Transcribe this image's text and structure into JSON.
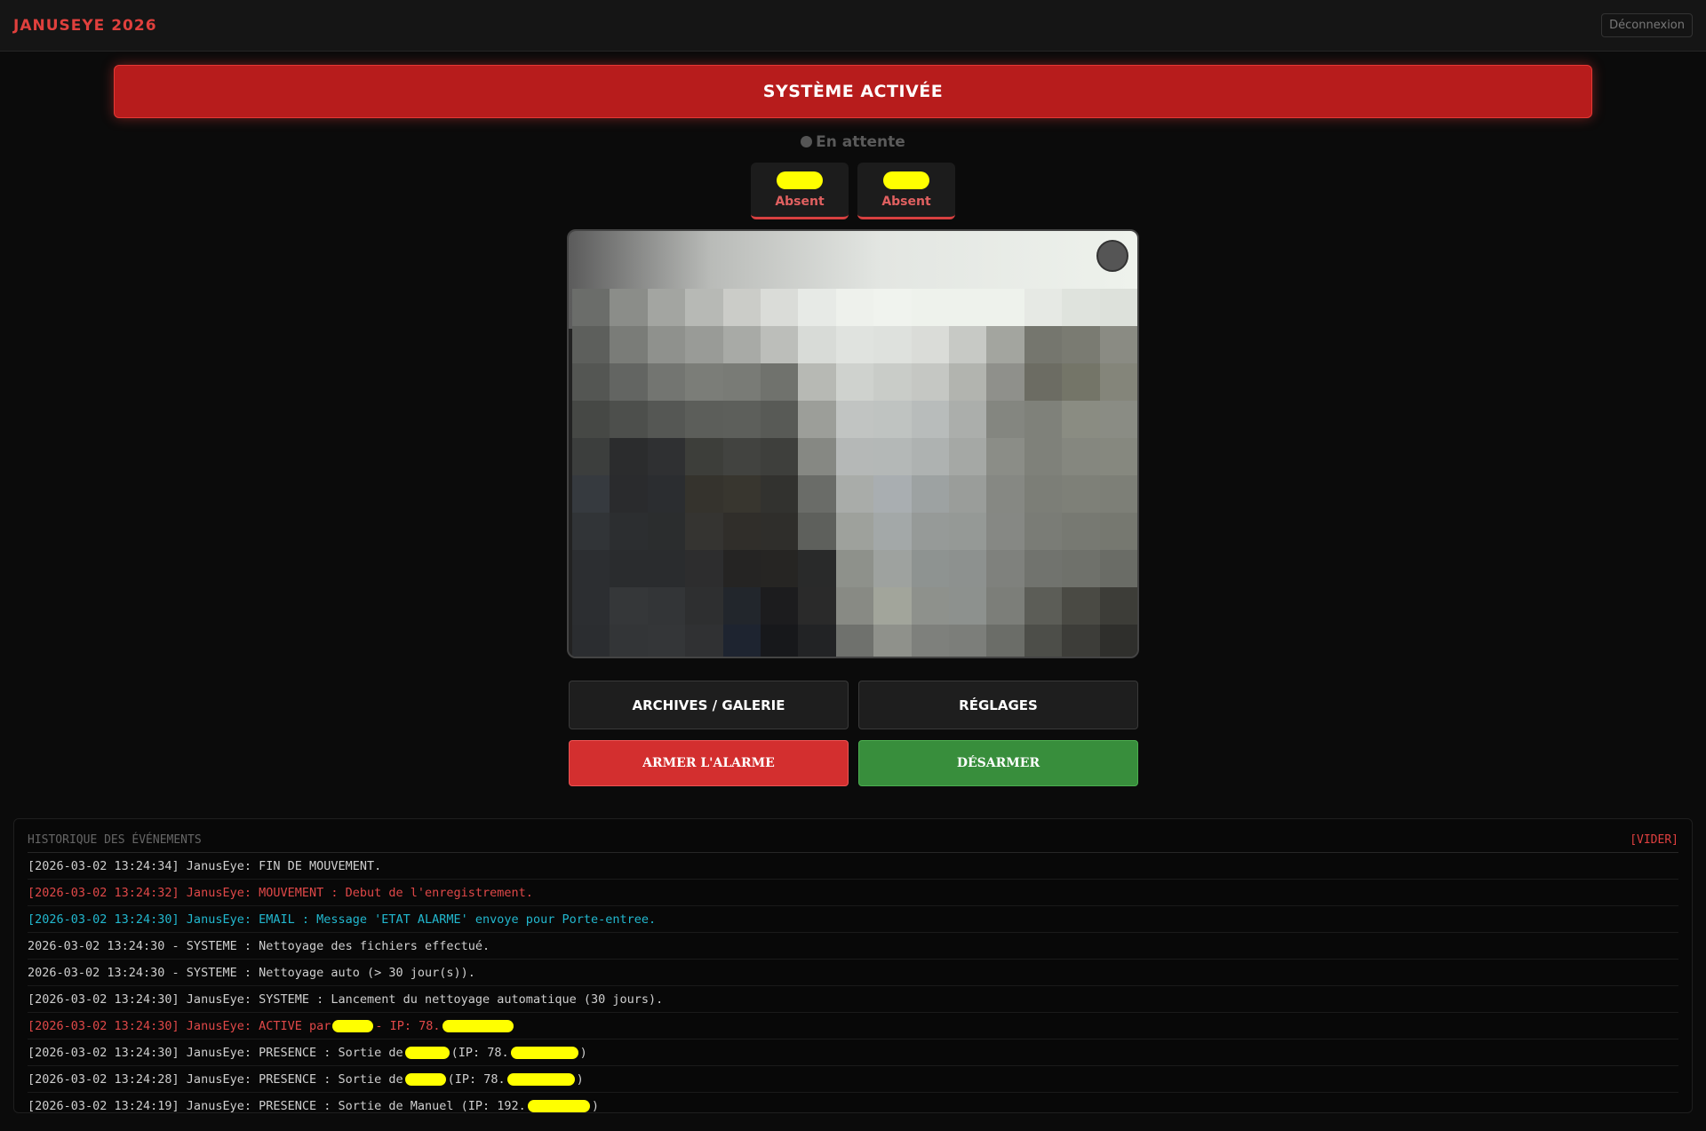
{
  "header": {
    "brand": "JANUSEYE 2026",
    "logout_label": "Déconnexion"
  },
  "status": {
    "banner": "SYSTÈME ACTIVÉE",
    "waiting": "En attente"
  },
  "presence": [
    {
      "status": "Absent"
    },
    {
      "status": "Absent"
    }
  ],
  "buttons": {
    "archives": "ARCHIVES / GALERIE",
    "settings": "RÉGLAGES",
    "arm": "ARMER L'ALARME",
    "disarm": "DÉSARMER"
  },
  "log": {
    "title": "HISTORIQUE DES ÉVÉNEMENTS",
    "clear_label": "[VIDER]",
    "lines": [
      {
        "text": "[2026-03-02 13:24:34] JanusEye: FIN DE MOUVEMENT.",
        "color": "normal"
      },
      {
        "text": "[2026-03-02 13:24:32] JanusEye: MOUVEMENT : Debut de l'enregistrement.",
        "color": "red"
      },
      {
        "text": "[2026-03-02 13:24:30] JanusEye: EMAIL : Message 'ETAT ALARME' envoye pour Porte-entree.",
        "color": "cyan"
      },
      {
        "text": "2026-03-02 13:24:30 - SYSTEME : Nettoyage des fichiers effectué.",
        "color": "normal"
      },
      {
        "text": "2026-03-02 13:24:30 - SYSTEME : Nettoyage auto (> 30 jour(s)).",
        "color": "normal"
      },
      {
        "text": "[2026-03-02 13:24:30] JanusEye: SYSTEME : Lancement du nettoyage automatique (30 jours).",
        "color": "normal"
      },
      {
        "text": "[2026-03-02 13:24:30] JanusEye: ACTIVE par",
        "mid": " - IP: 78.",
        "tail": "",
        "color": "red",
        "redactions": [
          46,
          80
        ]
      },
      {
        "text": "[2026-03-02 13:24:30] JanusEye: PRESENCE : Sortie de",
        "mid": "(IP: 78.",
        "tail": ")",
        "color": "normal",
        "redactions": [
          50,
          76
        ]
      },
      {
        "text": "[2026-03-02 13:24:28] JanusEye: PRESENCE : Sortie de",
        "mid": "(IP: 78.",
        "tail": ")",
        "color": "normal",
        "redactions": [
          46,
          76
        ]
      },
      {
        "text": "[2026-03-02 13:24:19] JanusEye: PRESENCE : Sortie de Manuel (IP: 192.",
        "mid": "",
        "tail": ")",
        "color": "normal",
        "redactions": [
          70
        ]
      }
    ]
  }
}
